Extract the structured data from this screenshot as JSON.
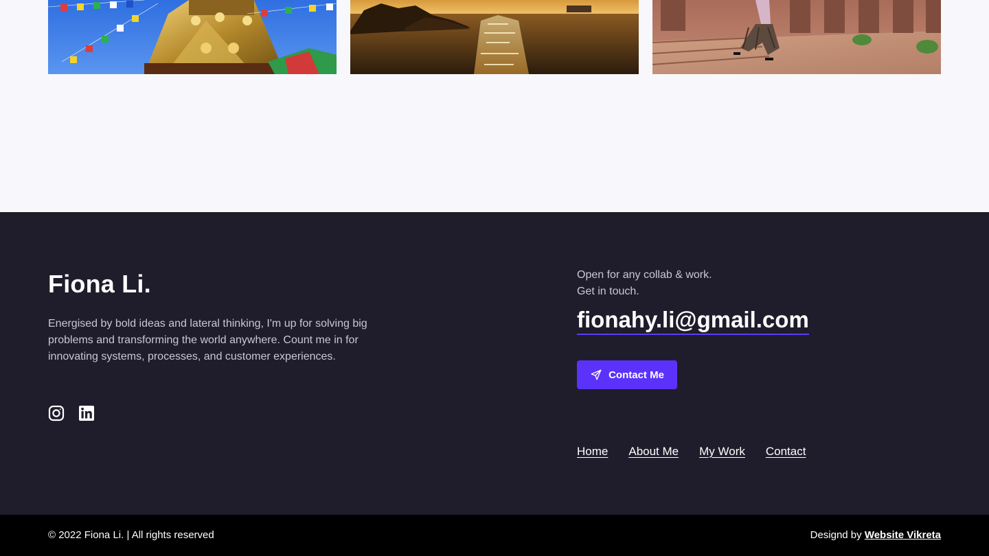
{
  "gallery": {
    "photos": [
      {
        "icon": "temple-prayer-flags-photo"
      },
      {
        "icon": "sunset-sea-photo"
      },
      {
        "icon": "courtyard-walking-person-photo"
      }
    ]
  },
  "footer": {
    "brand": "Fiona Li.",
    "bio": "Energised by bold ideas and lateral thinking, I'm up for solving big problems and transforming the world anywhere. Count me in for innovating systems, processes, and customer experiences.",
    "socials": [
      {
        "icon": "instagram-icon"
      },
      {
        "icon": "linkedin-icon"
      }
    ],
    "collab_line1": "Open for any collab & work.",
    "collab_line2": "Get in touch.",
    "email": "fionahy.li@gmail.com",
    "contact_button": {
      "label": "Contact Me",
      "icon": "send-icon"
    },
    "nav": [
      "Home",
      "About Me",
      "My Work",
      "Contact"
    ]
  },
  "bottom_bar": {
    "copyright": "© 2022 Fiona Li. | All rights reserved",
    "designed_by_prefix": "Designd by ",
    "designer": "Website Vikreta"
  },
  "colors": {
    "footer_bg": "#1f1d2b",
    "accent": "#5a32fa",
    "bottom_bg": "#000000",
    "page_bg": "#f7f7fc"
  }
}
